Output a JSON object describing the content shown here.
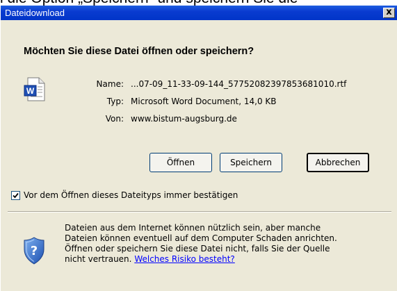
{
  "background_caption": "l die Option „Speichern“ und speichern Sie die",
  "window": {
    "title": "Dateidownload",
    "close_label": "x"
  },
  "question": "Möchten Sie diese Datei öffnen oder speichern?",
  "file": {
    "icon": "word-document-icon",
    "name_label": "Name:",
    "name_value": "...07-09_11-33-09-144_57752082397853681010.rtf",
    "type_label": "Typ:",
    "type_value": "Microsoft Word Document, 14,0 KB",
    "from_label": "Von:",
    "from_value": "www.bistum-augsburg.de"
  },
  "buttons": {
    "open": "Öffnen",
    "save": "Speichern",
    "cancel": "Abbrechen"
  },
  "confirm_checkbox": {
    "checked": true,
    "label": "Vor dem Öffnen dieses Dateityps immer bestätigen"
  },
  "warning": {
    "icon": "security-shield-icon",
    "line1": "Dateien aus dem Internet können nützlich sein, aber manche",
    "line2": "Dateien können eventuell auf dem Computer Schaden anrichten.",
    "line3": "Öffnen oder speichern Sie diese Datei nicht, falls Sie der Quelle",
    "line4_prefix": "nicht vertrauen.",
    "risk_link": "Welches Risiko besteht?"
  },
  "colors": {
    "titlebar": "#0a3bd0",
    "dialog_background": "#ece9d8",
    "link": "#0000ff"
  }
}
